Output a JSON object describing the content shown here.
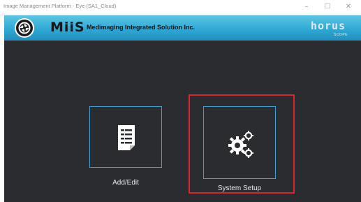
{
  "window": {
    "title": "Image Management Platform - Eye (SA1_Cloud)",
    "minimize_glyph": "–",
    "maximize_glyph": "☐",
    "close_glyph": "✕"
  },
  "header": {
    "brand": "MiiS",
    "company": "Medimaging Integrated Solution Inc.",
    "logo_icon": "aperture-logo-icon",
    "product_logo": "horus-scope-logo",
    "product_logo_text": "horus",
    "product_logo_subtext": "SCOPE",
    "colors": {
      "gradient_top": "#5bc6e4",
      "gradient_bottom": "#1f8fbd"
    }
  },
  "main": {
    "background": "#2b2c30",
    "tiles": [
      {
        "label": "Add/Edit",
        "icon": "document-edit-icon"
      },
      {
        "label": "System Setup",
        "icon": "gears-icon"
      }
    ],
    "colors": {
      "tile_border": "#3aa3cf",
      "highlight": "#d9252b"
    }
  }
}
